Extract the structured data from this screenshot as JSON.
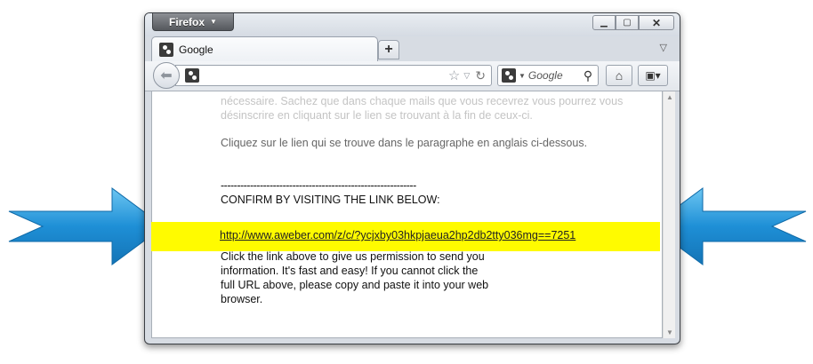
{
  "browser": {
    "menu_label": "Firefox",
    "tab_title": "Google",
    "url_value": "",
    "search_placeholder": "Google",
    "new_tab_label": "+"
  },
  "page": {
    "faded_line_1": "nécessaire. Sachez que dans chaque mails que vous recevrez vous pourrez vous",
    "faded_line_2": "désinscrire en cliquant sur le lien se trouvant à la fin de ceux-ci.",
    "instruction": "Cliquez sur le lien qui se trouve dans le paragraphe en anglais ci-dessous.",
    "separator": "------------------------------------------------------------",
    "confirm_heading": "CONFIRM BY VISITING THE LINK BELOW:",
    "confirm_link": "http://www.aweber.com/z/c/?ycjxby03hkpjaeua2hp2db2tty036mg==7251",
    "body_line_1": "Click the link above to give us permission to send you",
    "body_line_2": "information.  It's fast and easy!  If you cannot click the",
    "body_line_3": "full URL above, please copy and paste it into your web",
    "body_line_4": "browser."
  },
  "colors": {
    "highlight": "#fffb00",
    "arrow_blue": "#1e8fd6"
  }
}
